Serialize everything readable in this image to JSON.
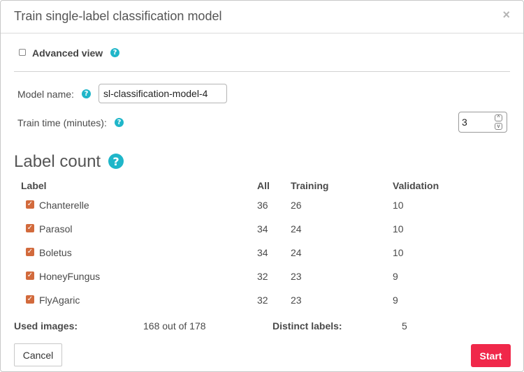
{
  "dialog": {
    "title": "Train single-label classification model",
    "close_glyph": "×"
  },
  "advanced_view": {
    "label": "Advanced view",
    "checked": false
  },
  "help_glyph": "?",
  "model_name": {
    "label": "Model name:",
    "value": "sl-classification-model-4"
  },
  "train_time": {
    "label": "Train time (minutes):",
    "value": "3",
    "up_glyph": "^",
    "down_glyph": "v"
  },
  "label_count": {
    "title": "Label count",
    "headers": {
      "label": "Label",
      "all": "All",
      "training": "Training",
      "validation": "Validation"
    },
    "rows": [
      {
        "label": "Chanterelle",
        "all": "36",
        "training": "26",
        "validation": "10",
        "checked": true
      },
      {
        "label": "Parasol",
        "all": "34",
        "training": "24",
        "validation": "10",
        "checked": true
      },
      {
        "label": "Boletus",
        "all": "34",
        "training": "24",
        "validation": "10",
        "checked": true
      },
      {
        "label": "HoneyFungus",
        "all": "32",
        "training": "23",
        "validation": "9",
        "checked": true
      },
      {
        "label": "FlyAgaric",
        "all": "32",
        "training": "23",
        "validation": "9",
        "checked": true
      }
    ],
    "check_glyph": "✓"
  },
  "summary": {
    "used_images_label": "Used images:",
    "used_images_value": "168 out of 178",
    "distinct_labels_label": "Distinct labels:",
    "distinct_labels_value": "5"
  },
  "buttons": {
    "cancel": "Cancel",
    "start": "Start"
  },
  "colors": {
    "accent": "#f0284a",
    "help": "#1fb6c9",
    "checkbox": "#d26a3c"
  }
}
